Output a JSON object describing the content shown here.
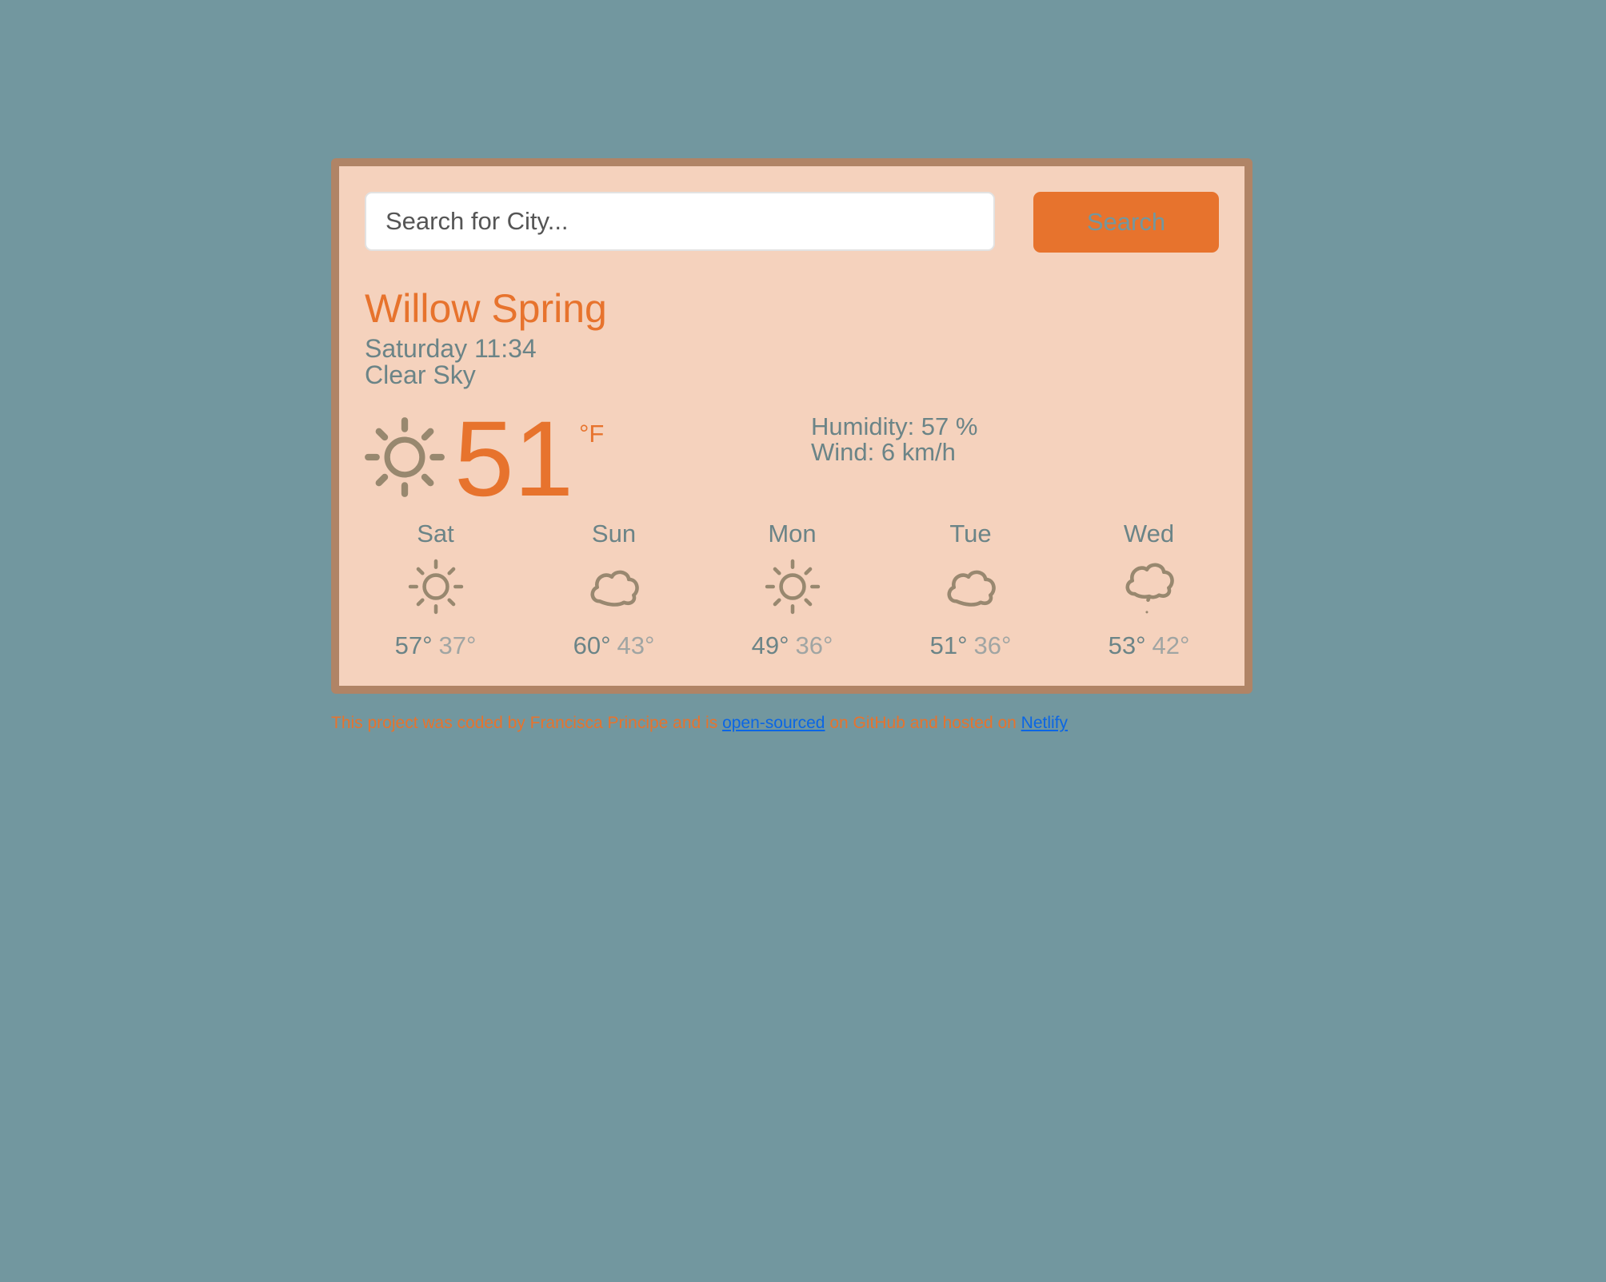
{
  "search": {
    "placeholder": "Search for City...",
    "button_label": "Search"
  },
  "current": {
    "city": "Willow Spring",
    "datetime": "Saturday 11:34",
    "condition": "Clear Sky",
    "icon": "sun-icon",
    "temperature": "51",
    "unit": "°F",
    "humidity": "Humidity: 57 %",
    "wind": "Wind: 6 km/h"
  },
  "forecast": [
    {
      "day": "Sat",
      "icon": "sun-icon",
      "max": "57°",
      "min": "37°"
    },
    {
      "day": "Sun",
      "icon": "cloud-icon",
      "max": "60°",
      "min": "43°"
    },
    {
      "day": "Mon",
      "icon": "sun-icon",
      "max": "49°",
      "min": "36°"
    },
    {
      "day": "Tue",
      "icon": "cloud-icon",
      "max": "51°",
      "min": "36°"
    },
    {
      "day": "Wed",
      "icon": "rain-cloud-icon",
      "max": "53°",
      "min": "42°"
    }
  ],
  "footer": {
    "text_before": "This project was coded by Francisca Principe and is ",
    "link1_label": "open-sourced",
    "text_middle": " on GitHub and hosted on ",
    "link2_label": "Netlify"
  },
  "colors": {
    "background": "#72979f",
    "card": "#f5d2bd",
    "card_border": "#b08466",
    "accent": "#e7732d",
    "text": "#6b8487",
    "icon": "#8f8067",
    "link": "#0b66e4"
  }
}
